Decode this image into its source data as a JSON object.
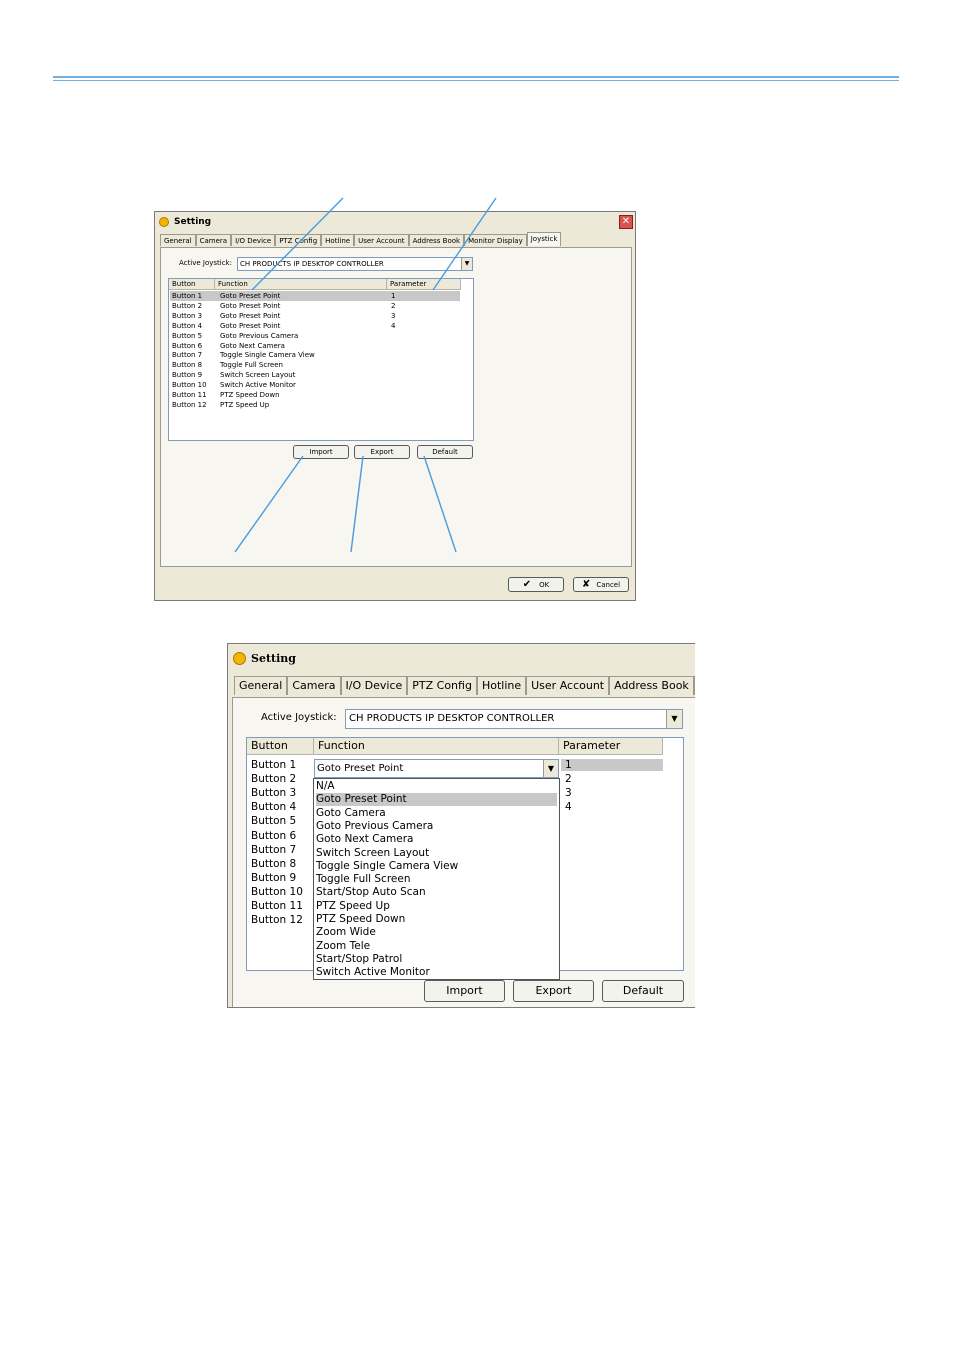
{
  "window1": {
    "title": "Setting",
    "tabs": [
      "General",
      "Camera",
      "I/O Device",
      "PTZ Config",
      "Hotline",
      "User Account",
      "Address Book",
      "Monitor Display",
      "Joystick"
    ],
    "active_joystick_label": "Active Joystick:",
    "active_joystick_value": "CH PRODUCTS IP DESKTOP CONTROLLER",
    "columns": [
      "Button",
      "Function",
      "Parameter"
    ],
    "rows": [
      {
        "button": "Button 1",
        "function": "Goto Preset Point",
        "parameter": "1"
      },
      {
        "button": "Button 2",
        "function": "Goto Preset Point",
        "parameter": "2"
      },
      {
        "button": "Button 3",
        "function": "Goto Preset Point",
        "parameter": "3"
      },
      {
        "button": "Button 4",
        "function": "Goto Preset Point",
        "parameter": "4"
      },
      {
        "button": "Button 5",
        "function": "Goto Previous Camera",
        "parameter": ""
      },
      {
        "button": "Button 6",
        "function": "Goto Next Camera",
        "parameter": ""
      },
      {
        "button": "Button 7",
        "function": "Toggle Single Camera View",
        "parameter": ""
      },
      {
        "button": "Button 8",
        "function": "Toggle Full Screen",
        "parameter": ""
      },
      {
        "button": "Button 9",
        "function": "Switch Screen Layout",
        "parameter": ""
      },
      {
        "button": "Button 10",
        "function": "Switch Active Monitor",
        "parameter": ""
      },
      {
        "button": "Button 11",
        "function": "PTZ Speed Down",
        "parameter": ""
      },
      {
        "button": "Button 12",
        "function": "PTZ Speed Up",
        "parameter": ""
      }
    ],
    "import_label": "Import",
    "export_label": "Export",
    "default_label": "Default",
    "ok_label": "OK",
    "cancel_label": "Cancel"
  },
  "window2": {
    "title": "Setting",
    "tabs": [
      "General",
      "Camera",
      "I/O Device",
      "PTZ Config",
      "Hotline",
      "User Account",
      "Address Book"
    ],
    "active_joystick_label": "Active Joystick:",
    "active_joystick_value": "CH PRODUCTS IP DESKTOP CONTROLLER",
    "columns": [
      "Button",
      "Function",
      "Parameter"
    ],
    "buttons": [
      "Button 1",
      "Button 2",
      "Button 3",
      "Button 4",
      "Button 5",
      "Button 6",
      "Button 7",
      "Button 8",
      "Button 9",
      "Button 10",
      "Button 11",
      "Button 12"
    ],
    "parameters": [
      "1",
      "2",
      "3",
      "4"
    ],
    "function_combo_value": "Goto Preset Point",
    "function_options": [
      "N/A",
      "Goto Preset Point",
      "Goto Camera",
      "Goto Previous Camera",
      "Goto Next Camera",
      "Switch Screen Layout",
      "Toggle Single Camera View",
      "Toggle Full Screen",
      "Start/Stop Auto Scan",
      "PTZ Speed Up",
      "PTZ Speed Down",
      "Zoom Wide",
      "Zoom Tele",
      "Start/Stop Patrol",
      "Switch Active Monitor"
    ],
    "selected_option": "Goto Preset Point",
    "import_label": "Import",
    "export_label": "Export",
    "default_label": "Default"
  },
  "colors": {
    "rule": "#6fb0e6",
    "callout": "#4a9be0",
    "selection": "#c8c8c8",
    "window_bg": "#ece9d8"
  }
}
